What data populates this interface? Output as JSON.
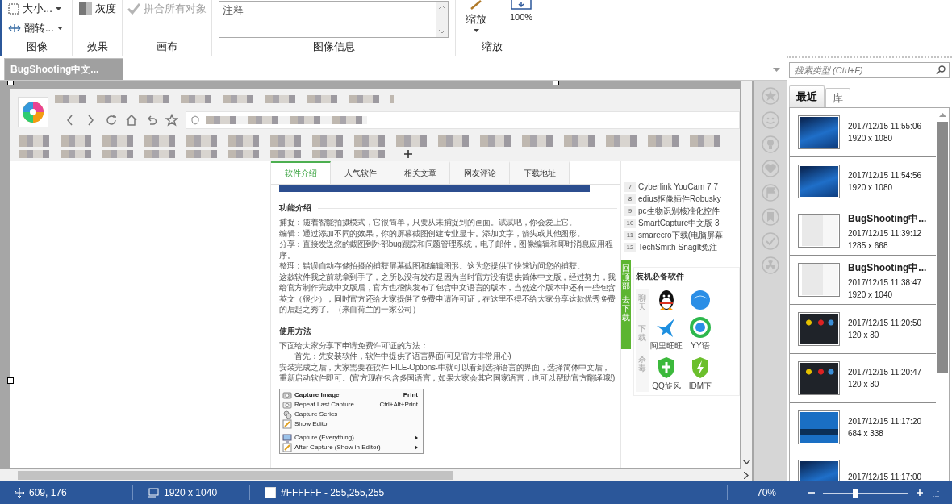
{
  "ribbon": {
    "groups": [
      {
        "label": "图像",
        "items": [
          {
            "kind": "dropdown",
            "label": "大小...",
            "disabled": false
          },
          {
            "kind": "dropdown",
            "label": "翻转...",
            "disabled": false
          }
        ]
      },
      {
        "label": "效果",
        "items": [
          {
            "kind": "button",
            "label": "灰度",
            "disabled": false
          }
        ]
      },
      {
        "label": "画布",
        "items": [
          {
            "kind": "button",
            "label": "拼合所有对象",
            "disabled": true
          }
        ]
      },
      {
        "label": "图像信息",
        "items": [
          {
            "kind": "textarea",
            "placeholder": "注释"
          }
        ]
      },
      {
        "label": "缩放",
        "items": [
          {
            "kind": "split-button",
            "label": "缩放",
            "disabled": false
          },
          {
            "kind": "large-button",
            "label": "100%",
            "disabled": false
          }
        ]
      }
    ]
  },
  "document_tabs": [
    {
      "label": "BugShooting中文...",
      "selected": true
    }
  ],
  "screenshot": {
    "page_tabs": [
      {
        "label": "软件介绍",
        "selected": true
      },
      {
        "label": "人气软件",
        "selected": false
      },
      {
        "label": "相关文章",
        "selected": false
      },
      {
        "label": "网友评论",
        "selected": false
      },
      {
        "label": "下载地址",
        "selected": false
      }
    ],
    "sections": [
      {
        "heading": "功能介绍",
        "paragraphs": [
          "捕捉：随着智能拍摄模式，它很简单，只要从未捕捉到的画面。试试吧，你会爱上它。",
          "编辑：通过添加不同的效果，你的屏幕截图创建专业显卡。添加文字，箭头或其他图形。",
          "分享：直接发送您的截图到外部bug跟踪和问题管理系统，电子邮件，图像编辑和即时消息应用程序。",
          "整理：错误自动存储拍摄的捕获屏幕截图和编辑图形。这为您提供了快速访问您的捕获。",
          "这款软件我之前就拿到手了，之所以没有发布是因为当时官方没有提供简体中文版，经过努力，我给官方制作完成中文版后，官方也很快发布了包含中文语言的版本，当然这个版本中还有一些包含英文（很少），同时官方还给大家提供了免费申请许可证，在这里不得不给大家分享这款优秀免费的后起之秀了。（来自荷兰的一家公司）"
        ]
      },
      {
        "heading": "使用方法",
        "paragraphs": [
          "下面给大家分享下申请免费许可证的方法：",
          "　　首先：先安装软件，软件中提供了语言界面(可见官方非常用心)",
          "安装完成之后，大家需要在软件 FILE-Options-中就可以看到选择语言的界面，选择简体中文后，重新启动软件即可。(官方现在包含多国语言，如果大家会其它国家语言，也可以帮助官方翻译哦!)"
        ]
      }
    ],
    "context_menu": [
      {
        "label": "Capture Image",
        "shortcut": "Print",
        "bold": true,
        "submenu": false
      },
      {
        "label": "Repeat Last Capture",
        "shortcut": "Ctrl+Alt+Print",
        "bold": false,
        "submenu": false
      },
      {
        "label": "Capture Series",
        "bold": false,
        "submenu": false
      },
      {
        "label": "Show Editor",
        "bold": false,
        "submenu": false
      },
      {
        "label": "Capture (Everything)",
        "bold": false,
        "submenu": true
      },
      {
        "label": "After Capture (Show in Editor)",
        "bold": false,
        "submenu": true
      }
    ],
    "ranked_list": [
      {
        "number": "7",
        "title": "Cyberlink YouCam 7 7"
      },
      {
        "number": "8",
        "title": "edius抠像插件Robusky"
      },
      {
        "number": "9",
        "title": "pc生物识别核准化控件"
      },
      {
        "number": "10",
        "title": "SmartCapture中文版 3"
      },
      {
        "number": "11",
        "title": "smarecro下载(电脑屏幕"
      },
      {
        "number": "12",
        "title": "TechSmith SnagIt免注"
      }
    ],
    "float_bar": [
      "回顶部",
      "去下载"
    ],
    "software_box": {
      "title": "装机必备软件",
      "categories": [
        "聊天",
        "下载",
        "杀毒"
      ],
      "apps": [
        {
          "kind": "penguin"
        },
        {
          "kind": "globe"
        },
        {
          "kind": "bird",
          "label": "阿里旺旺"
        },
        {
          "kind": "ring",
          "label": "YY语"
        },
        {
          "kind": "shield",
          "label": "QQ旋风"
        },
        {
          "kind": "bolt-shield",
          "label": "IDM下"
        }
      ]
    }
  },
  "history": {
    "search": {
      "placeholder": "搜索类型 (Ctrl+F)"
    },
    "tabs": [
      {
        "label": "最近",
        "selected": true
      },
      {
        "label": "库",
        "selected": false
      }
    ],
    "items": [
      {
        "kind": "desktop",
        "date": "2017/12/15 11:55:06",
        "size": "1920 x 1080"
      },
      {
        "kind": "desktop",
        "date": "2017/12/15 11:54:56",
        "size": "1920 x 1080"
      },
      {
        "kind": "window",
        "title": "BugShooting中...",
        "date": "2017/12/15 11:39:12",
        "size": "1285 x 668"
      },
      {
        "kind": "window",
        "title": "BugShooting中...",
        "date": "2017/12/15 11:38:47",
        "size": "1920 x 1040"
      },
      {
        "kind": "tray",
        "date": "2017/12/15 11:20:50",
        "size": "120 x 80"
      },
      {
        "kind": "tray",
        "date": "2017/12/15 11:20:47",
        "size": "120 x 80"
      },
      {
        "kind": "banner",
        "date": "2017/12/15 11:17:20",
        "size": "684 x 338"
      },
      {
        "kind": "desktop",
        "date": "2017/12/15 11:17:00"
      }
    ]
  },
  "status_bar": {
    "position": "609, 176",
    "image_size": "1920 x 1040",
    "color": "#ffffff",
    "color_text": "#FFFFFF - 255,255,255",
    "zoom": "70%",
    "zoom_slider": {
      "level": 0.35
    }
  }
}
